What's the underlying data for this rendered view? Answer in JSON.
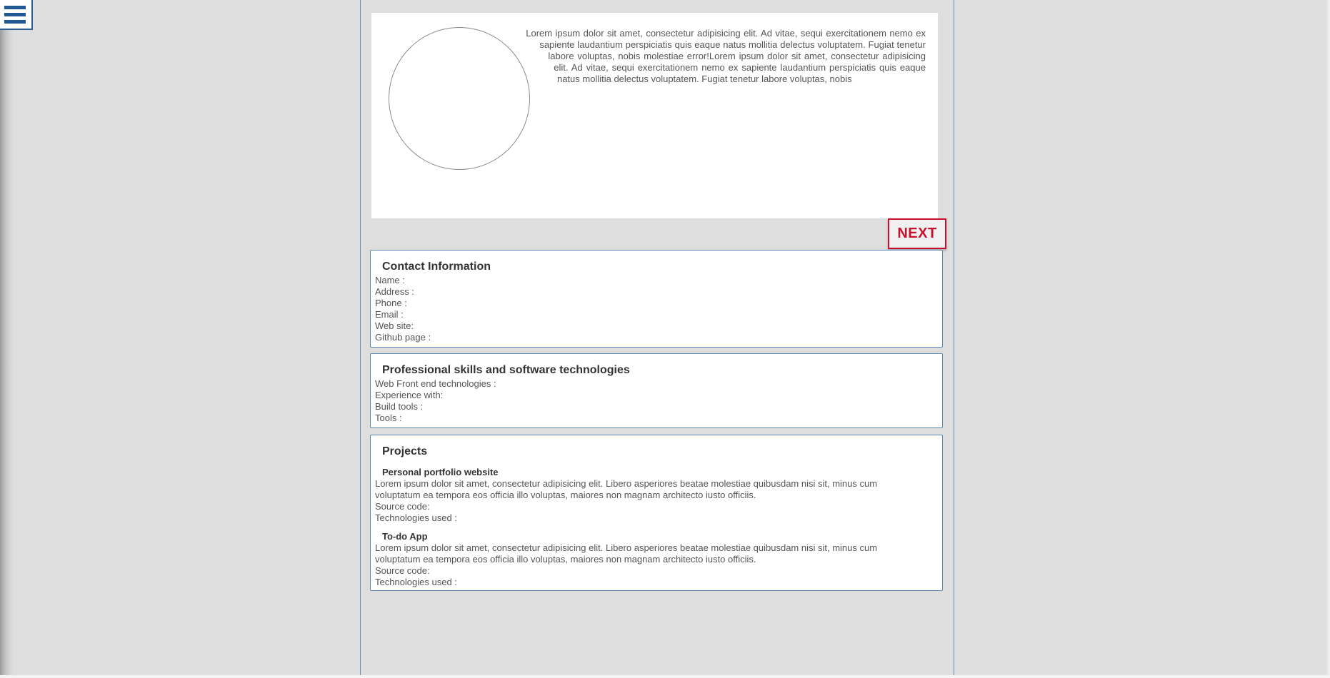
{
  "menu": {
    "icon": "hamburger-icon"
  },
  "hero": {
    "text": "Lorem ipsum dolor sit amet, consectetur adipisicing elit. Ad vitae, sequi exercitationem nemo ex sapiente laudantium perspiciatis quis eaque natus mollitia delectus voluptatem. Fugiat tenetur labore voluptas, nobis molestiae error!Lorem ipsum dolor sit amet, consectetur adipisicing elit. Ad vitae, sequi exercitationem nemo ex sapiente laudantium perspiciatis quis eaque natus mollitia delectus voluptatem. Fugiat tenetur labore voluptas, nobis"
  },
  "next_button": {
    "label": "NEXT"
  },
  "contact": {
    "title": "Contact Information",
    "fields": [
      "Name :",
      "Address :",
      "Phone :",
      "Email :",
      "Web site:",
      "Github page :"
    ]
  },
  "skills": {
    "title": "Professional skills and software technologies",
    "fields": [
      "Web Front end technologies :",
      "Experience with:",
      "Build tools :",
      "Tools :"
    ]
  },
  "projects": {
    "title": "Projects",
    "items": [
      {
        "name": "Personal portfolio website",
        "description": "Lorem ipsum dolor sit amet, consectetur adipisicing elit. Libero asperiores beatae molestiae quibusdam nisi sit, minus cum voluptatum ea tempora eos officia illo voluptas, maiores non magnam architecto iusto officiis.",
        "source": "Source code:",
        "tech": "Technologies used :"
      },
      {
        "name": "To-do App",
        "description": "Lorem ipsum dolor sit amet, consectetur adipisicing elit. Libero asperiores beatae molestiae quibusdam nisi sit, minus cum voluptatum ea tempora eos officia illo voluptas, maiores non magnam architecto iusto officiis.",
        "source": "Source code:",
        "tech": "Technologies used :"
      }
    ]
  },
  "colors": {
    "background": "#dedede",
    "accent": "#1f5a94",
    "next": "#c8102e"
  }
}
